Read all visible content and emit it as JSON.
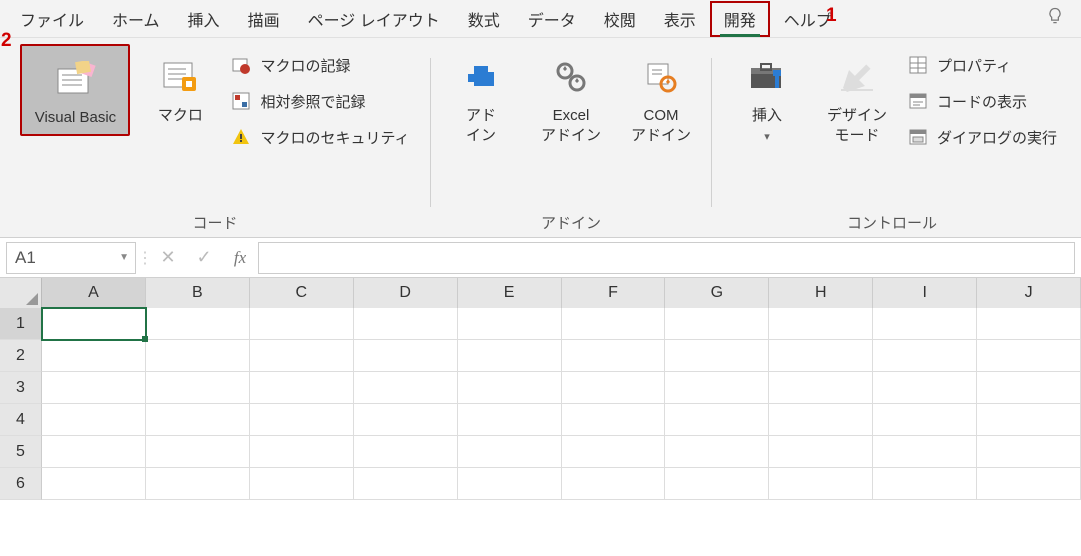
{
  "annotations": {
    "one": "1",
    "two": "2"
  },
  "tabs": {
    "file": "ファイル",
    "home": "ホーム",
    "insert": "挿入",
    "draw": "描画",
    "pagelayout": "ページ レイアウト",
    "formulas": "数式",
    "data": "データ",
    "review": "校閲",
    "view": "表示",
    "developer": "開発",
    "help": "ヘルプ"
  },
  "ribbon": {
    "code": {
      "group_label": "コード",
      "visual_basic": "Visual Basic",
      "macros": "マクロ",
      "record_macro": "マクロの記録",
      "relative_ref": "相対参照で記録",
      "macro_security": "マクロのセキュリティ"
    },
    "addins": {
      "group_label": "アドイン",
      "addins": "アド\nイン",
      "excel_addins": "Excel\nアドイン",
      "com_addins": "COM\nアドイン"
    },
    "controls": {
      "group_label": "コントロール",
      "insert": "挿入",
      "design_mode": "デザイン\nモード",
      "properties": "プロパティ",
      "view_code": "コードの表示",
      "run_dialog": "ダイアログの実行"
    }
  },
  "formula_bar": {
    "namebox": "A1",
    "fx": "fx"
  },
  "grid": {
    "cols": [
      "A",
      "B",
      "C",
      "D",
      "E",
      "F",
      "G",
      "H",
      "I",
      "J"
    ],
    "rows": [
      "1",
      "2",
      "3",
      "4",
      "5",
      "6"
    ]
  }
}
